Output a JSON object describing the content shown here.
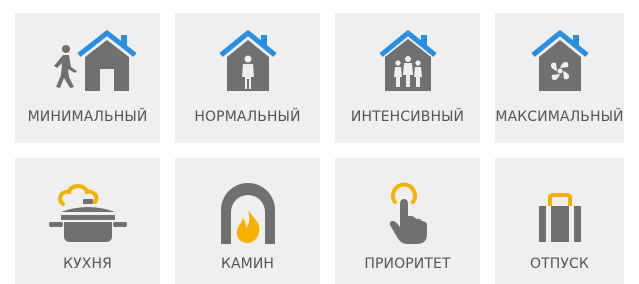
{
  "colors": {
    "tile_bg": "#efefef",
    "roof": "#2a8fe0",
    "gray": "#707070",
    "accent": "#f5b000",
    "text": "#555555"
  },
  "modes": [
    {
      "label": "МИНИМАЛЬНЫЙ",
      "icon": "walking-person-house-icon"
    },
    {
      "label": "НОРМАЛЬНЫЙ",
      "icon": "person-house-icon"
    },
    {
      "label": "ИНТЕНСИВНЫЙ",
      "icon": "group-house-icon"
    },
    {
      "label": "МАКСИМАЛЬНЫЙ",
      "icon": "fan-house-icon"
    }
  ],
  "functions": [
    {
      "label": "КУХНЯ",
      "icon": "cooking-pot-icon"
    },
    {
      "label": "КАМИН",
      "icon": "fireplace-icon"
    },
    {
      "label": "ПРИОРИТЕТ",
      "icon": "touch-finger-icon"
    },
    {
      "label": "ОТПУСК",
      "icon": "suitcase-icon"
    }
  ]
}
